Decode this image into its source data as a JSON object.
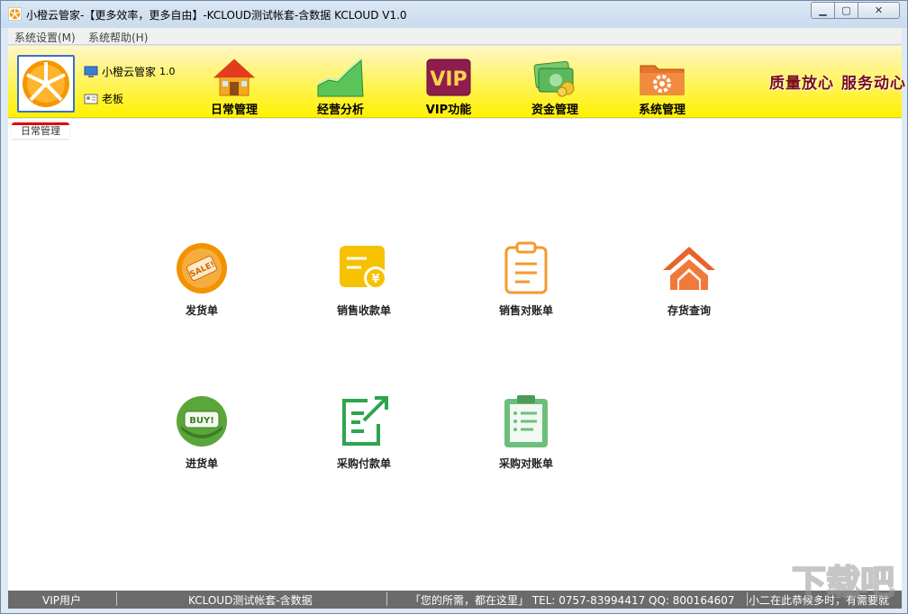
{
  "window": {
    "title": "小橙云管家-【更多效率，更多自由】-KCLOUD测试帐套-含数据  KCLOUD V1.0",
    "controls": {
      "minimize": "▁",
      "maximize": "▢",
      "close": "✕"
    }
  },
  "menubar": {
    "items": [
      "系统设置(M)",
      "系统帮助(H)"
    ]
  },
  "banner": {
    "user": {
      "app_name": "小橙云管家",
      "version": "1.0",
      "role": "老板"
    },
    "tools": [
      {
        "label": "日常管理",
        "icon": "house-icon"
      },
      {
        "label": "经营分析",
        "icon": "growth-chart-icon"
      },
      {
        "label": "VIP功能",
        "icon": "vip-icon"
      },
      {
        "label": "资金管理",
        "icon": "money-icon"
      },
      {
        "label": "系统管理",
        "icon": "gear-folder-icon"
      }
    ],
    "slogans": [
      "质量放心",
      "服务动心"
    ],
    "colors": {
      "background": "#fff100",
      "slogan": "#7a0e0e",
      "logo_border": "#3d6fd0"
    }
  },
  "content": {
    "active_tab": "日常管理",
    "functions": [
      {
        "label": "发货单",
        "icon": "sale-tag-icon"
      },
      {
        "label": "销售收款单",
        "icon": "yuan-receipt-icon"
      },
      {
        "label": "销售对账单",
        "icon": "clipboard-icon"
      },
      {
        "label": "存货查询",
        "icon": "warehouse-icon"
      },
      {
        "label": "进货单",
        "icon": "buy-tag-icon"
      },
      {
        "label": "采购付款单",
        "icon": "payment-export-icon"
      },
      {
        "label": "采购对账单",
        "icon": "checklist-clipboard-icon"
      }
    ]
  },
  "statusbar": {
    "user_type": "VIP用户",
    "account": "KCLOUD测试帐套-含数据",
    "contact": "「您的所需，都在这里」 TEL: 0757-83994417  QQ: 800164607",
    "marquee": "小二在此恭候多时，有需要就"
  },
  "watermark": {
    "text": "下载吧"
  }
}
